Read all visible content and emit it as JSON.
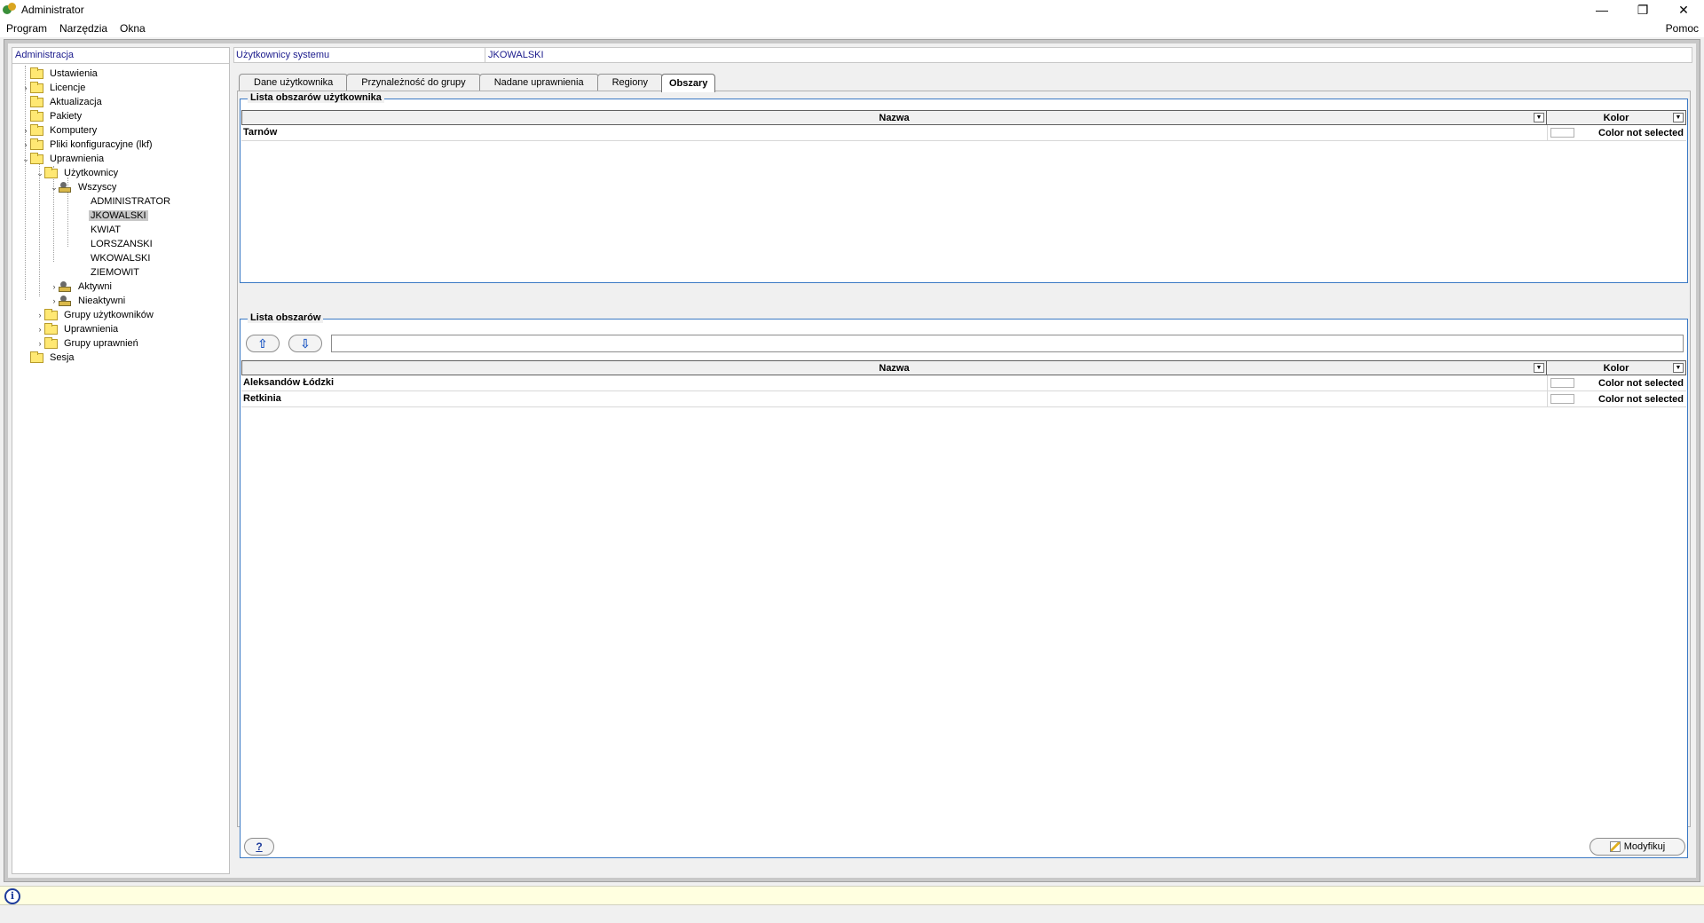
{
  "window": {
    "title": "Administrator",
    "minimize": "—",
    "restore": "❐",
    "close": "✕"
  },
  "menu": {
    "items": [
      "Program",
      "Narzędzia",
      "Okna"
    ],
    "help": "Pomoc"
  },
  "left": {
    "header": "Administracja",
    "tree": [
      {
        "label": "Ustawienia"
      },
      {
        "label": "Licencje"
      },
      {
        "label": "Aktualizacja"
      },
      {
        "label": "Pakiety"
      },
      {
        "label": "Komputery"
      },
      {
        "label": "Pliki konfiguracyjne (lkf)"
      },
      {
        "label": "Uprawnienia"
      },
      {
        "label": "Użytkownicy"
      },
      {
        "label": "Wszyscy"
      },
      {
        "label": "ADMINISTRATOR"
      },
      {
        "label": "JKOWALSKI"
      },
      {
        "label": "KWIAT"
      },
      {
        "label": "LORSZANSKI"
      },
      {
        "label": "WKOWALSKI"
      },
      {
        "label": "ZIEMOWIT"
      },
      {
        "label": "Aktywni"
      },
      {
        "label": "Nieaktywni"
      },
      {
        "label": "Grupy użytkowników"
      },
      {
        "label": "Uprawnienia"
      },
      {
        "label": "Grupy uprawnień"
      },
      {
        "label": "Sesja"
      }
    ]
  },
  "right": {
    "breadcrumb": [
      "Użytkownicy systemu",
      "JKOWALSKI"
    ],
    "tabs": [
      "Dane użytkownika",
      "Przynależność do grupy",
      "Nadane uprawnienia",
      "Regiony",
      "Obszary"
    ],
    "user_areas": {
      "title": "Lista obszarów użytkownika",
      "columns": [
        "Nazwa",
        "Kolor"
      ],
      "rows": [
        {
          "name": "Tarnów",
          "color": "Color not selected"
        }
      ]
    },
    "all_areas": {
      "title": "Lista obszarów",
      "up_icon": "⇧",
      "down_icon": "⇩",
      "filter_value": "",
      "columns": [
        "Nazwa",
        "Kolor"
      ],
      "rows": [
        {
          "name": "Aleksandów Łódzki",
          "color": "Color not selected"
        },
        {
          "name": "Retkinia",
          "color": "Color not selected"
        }
      ]
    },
    "help_button": "?",
    "modify_button": "Modyfikuj"
  },
  "status": {
    "info_icon": "i"
  }
}
